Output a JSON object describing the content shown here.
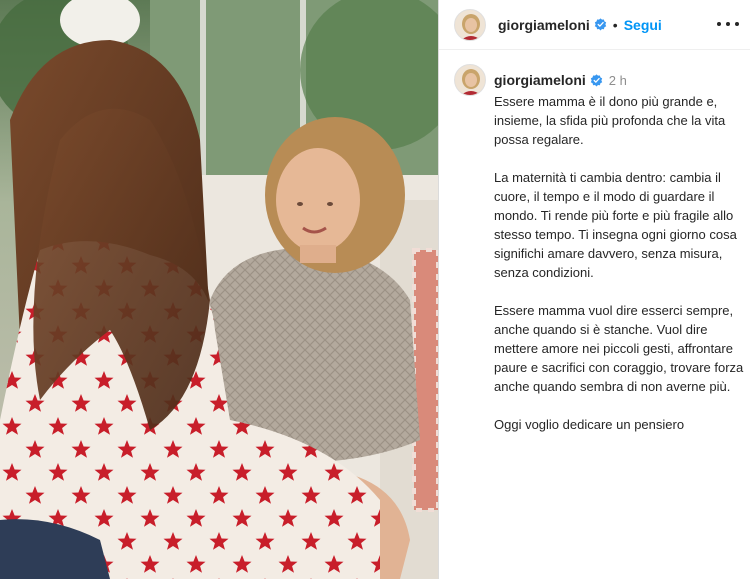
{
  "post": {
    "photo_alt": "photo",
    "username": "giorgiameloni",
    "follow_label": "Segui",
    "dot": "•",
    "time_ago": "2 h",
    "caption_paragraphs": [
      "Essere mamma è il dono più grande e, insieme, la sfida più profonda che la vita possa regalare.",
      "La maternità ti cambia dentro: cambia il cuore, il tempo e il modo di guardare il mondo. Ti rende più forte e più fragile allo stesso tempo. Ti insegna ogni giorno cosa significhi amare davvero, senza misura, senza condizioni.",
      "Essere mamma vuol dire esserci sempre, anche quando si è stanche. Vuol dire mettere amore nei piccoli gesti, affrontare paure e sacrifici con coraggio, trovare forza anche quando sembra di non averne più.",
      "Oggi voglio dedicare un pensiero"
    ]
  },
  "colors": {
    "accent": "#0095f6",
    "verified": "#3897f0",
    "text": "#262626",
    "muted": "#8e8e8e",
    "star": "#c81e2a"
  },
  "icons": {
    "verified": "verified-badge-icon",
    "more": "more-options-icon"
  }
}
